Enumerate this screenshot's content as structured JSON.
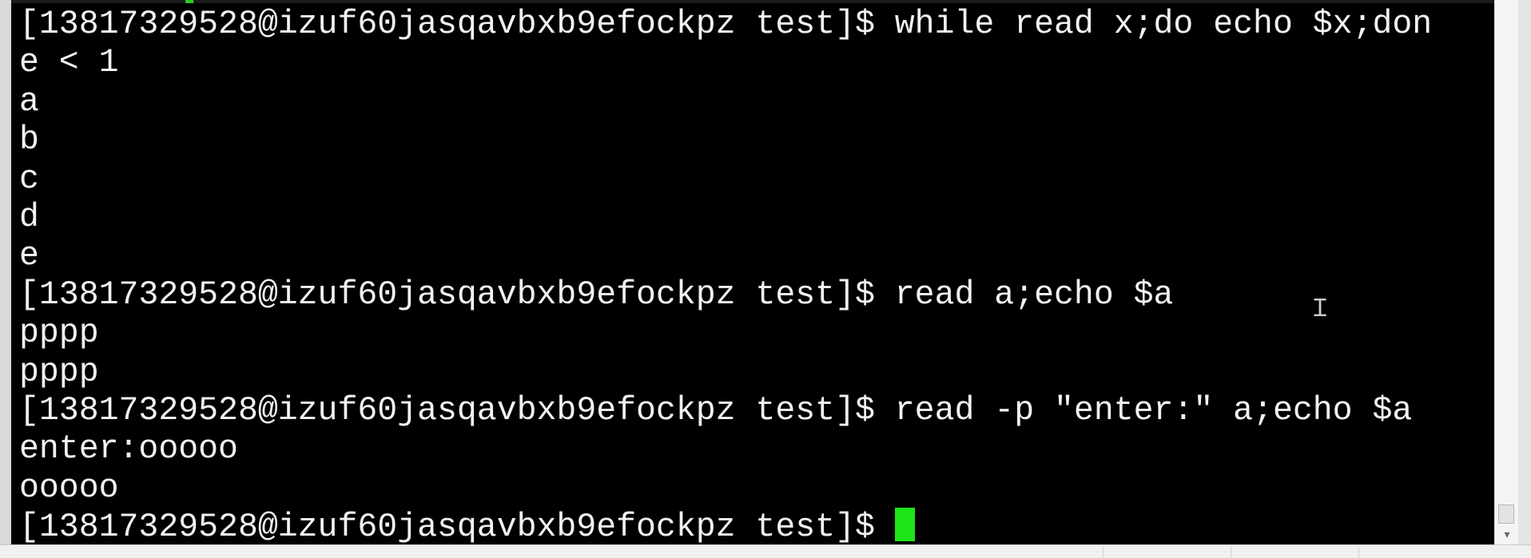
{
  "terminal": {
    "lines": [
      "[13817329528@izuf60jasqavbxb9efockpz test]$ while read x;do echo $x;don",
      "e < 1",
      "a",
      "b",
      "c",
      "d",
      "e",
      "[13817329528@izuf60jasqavbxb9efockpz test]$ read a;echo $a",
      "pppp",
      "pppp",
      "[13817329528@izuf60jasqavbxb9efockpz test]$ read -p \"enter:\" a;echo $a",
      "enter:ooooo",
      "ooooo"
    ],
    "prompt": "[13817329528@izuf60jasqavbxb9efockpz test]$ ",
    "colors": {
      "background": "#000000",
      "foreground": "#f2f2f2",
      "cursor": "#1ee41a"
    }
  }
}
